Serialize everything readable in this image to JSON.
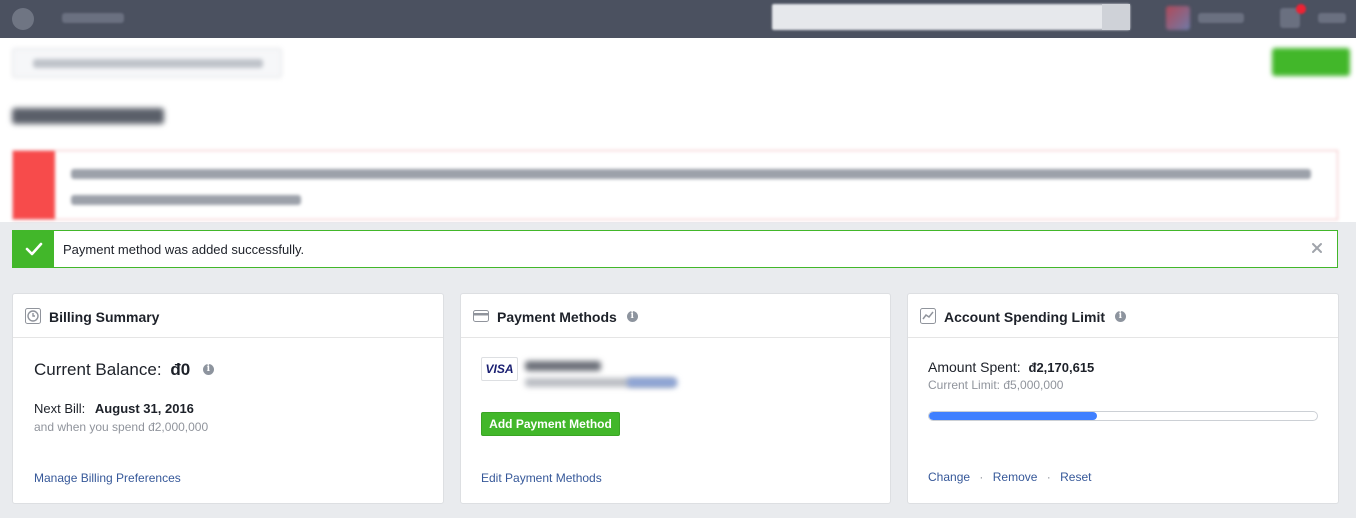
{
  "success_banner": {
    "message": "Payment method was added successfully."
  },
  "billing_summary": {
    "title": "Billing Summary",
    "balance_label": "Current Balance:",
    "balance_value": "đ0",
    "next_bill_label": "Next Bill:",
    "next_bill_date": "August 31, 2016",
    "threshold_note": "and when you spend đ2,000,000",
    "manage_link": "Manage Billing Preferences"
  },
  "payment_methods": {
    "title": "Payment Methods",
    "card_brand": "VISA",
    "add_button": "Add Payment Method",
    "edit_link": "Edit Payment Methods"
  },
  "spending_limit": {
    "title": "Account Spending Limit",
    "amount_label": "Amount Spent:",
    "amount_value": "đ2,170,615",
    "current_limit": "Current Limit: đ5,000,000",
    "progress_fraction": 0.434,
    "actions": [
      "Change",
      "Remove",
      "Reset"
    ],
    "separator": "·"
  },
  "colors": {
    "topbar": "#4b5160",
    "success_green": "#42b72a",
    "link_blue": "#365899",
    "progress_blue": "#4080ff",
    "warning_red": "#f74b4b"
  }
}
